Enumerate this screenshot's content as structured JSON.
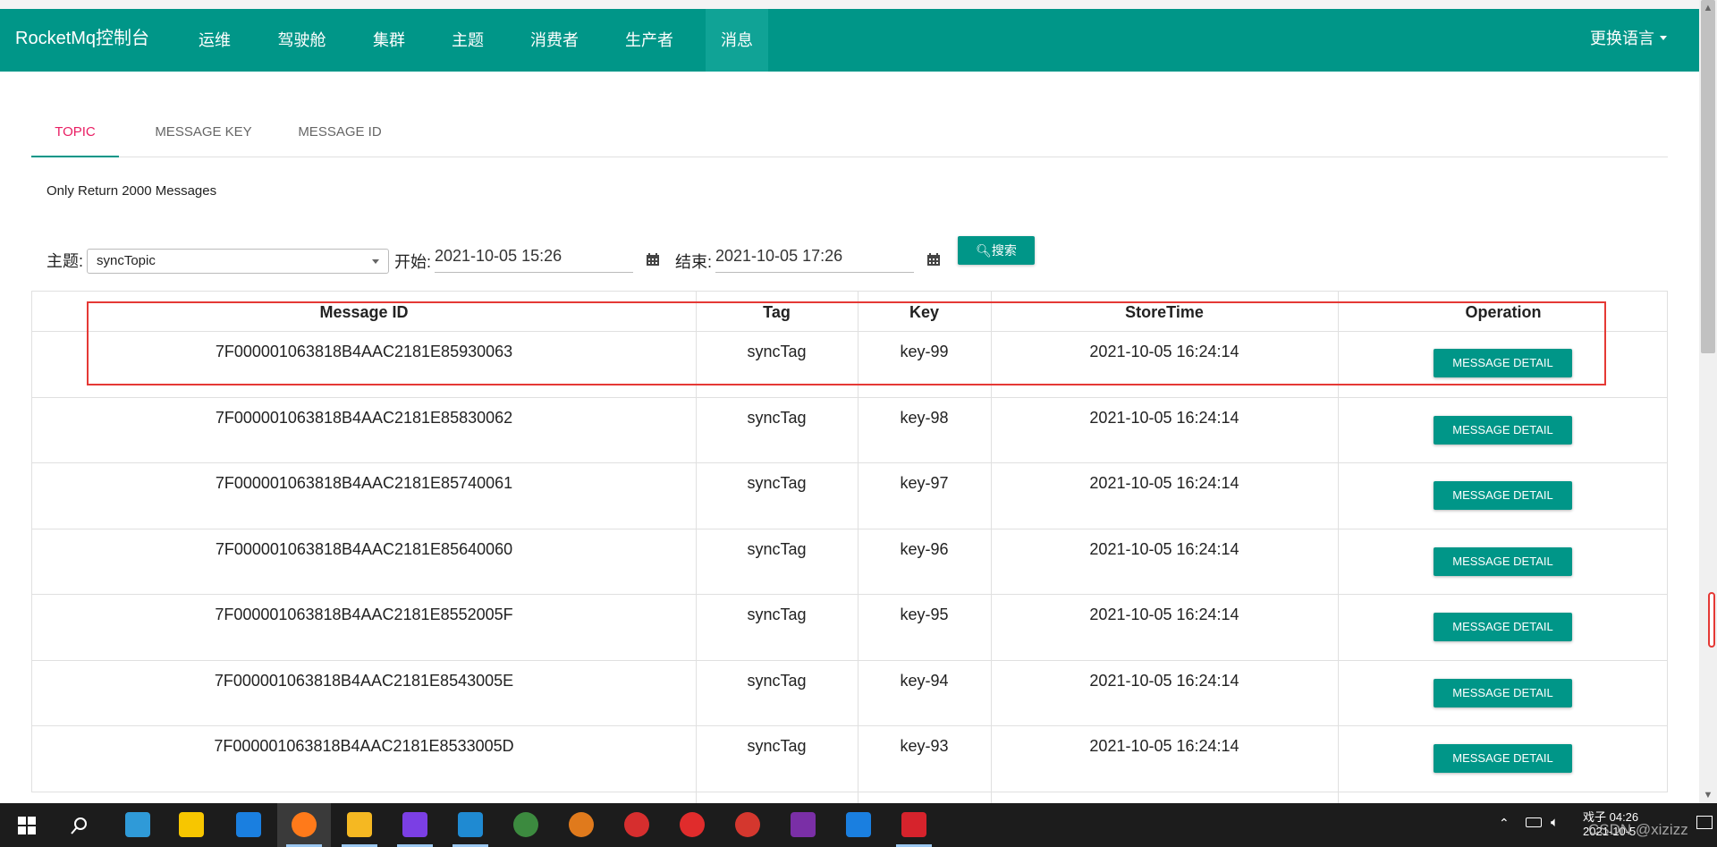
{
  "navbar": {
    "brand": "RocketMq控制台",
    "items": [
      {
        "label": "运维"
      },
      {
        "label": "驾驶舱"
      },
      {
        "label": "集群"
      },
      {
        "label": "主题"
      },
      {
        "label": "消费者"
      },
      {
        "label": "生产者"
      },
      {
        "label": "消息"
      }
    ],
    "active_item": "消息",
    "language_label": "更换语言"
  },
  "tabs": [
    {
      "label": "TOPIC"
    },
    {
      "label": "MESSAGE KEY"
    },
    {
      "label": "MESSAGE ID"
    }
  ],
  "active_tab": "TOPIC",
  "notice": "Only Return 2000 Messages",
  "filter": {
    "topic_label": "主题:",
    "topic_value": "syncTopic",
    "start_label": "开始:",
    "start_value": "2021-10-05 15:26",
    "end_label": "结束:",
    "end_value": "2021-10-05 17:26",
    "search_label": "搜索",
    "search_icon": "magnifier-icon",
    "calendar_icon": "calendar-icon"
  },
  "table": {
    "columns": [
      "Message ID",
      "Tag",
      "Key",
      "StoreTime",
      "Operation"
    ],
    "rows": [
      {
        "id": "7F000001063818B4AAC2181E85930063",
        "tag": "syncTag",
        "key": "key-99",
        "time": "2021-10-05 16:24:14",
        "op": "MESSAGE DETAIL"
      },
      {
        "id": "7F000001063818B4AAC2181E85830062",
        "tag": "syncTag",
        "key": "key-98",
        "time": "2021-10-05 16:24:14",
        "op": "MESSAGE DETAIL"
      },
      {
        "id": "7F000001063818B4AAC2181E85740061",
        "tag": "syncTag",
        "key": "key-97",
        "time": "2021-10-05 16:24:14",
        "op": "MESSAGE DETAIL"
      },
      {
        "id": "7F000001063818B4AAC2181E85640060",
        "tag": "syncTag",
        "key": "key-96",
        "time": "2021-10-05 16:24:14",
        "op": "MESSAGE DETAIL"
      },
      {
        "id": "7F000001063818B4AAC2181E8552005F",
        "tag": "syncTag",
        "key": "key-95",
        "time": "2021-10-05 16:24:14",
        "op": "MESSAGE DETAIL"
      },
      {
        "id": "7F000001063818B4AAC2181E8543005E",
        "tag": "syncTag",
        "key": "key-94",
        "time": "2021-10-05 16:24:14",
        "op": "MESSAGE DETAIL"
      },
      {
        "id": "7F000001063818B4AAC2181E8533005D",
        "tag": "syncTag",
        "key": "key-93",
        "time": "2021-10-05 16:24:14",
        "op": "MESSAGE DETAIL"
      }
    ]
  },
  "taskbar": {
    "time": "戏子 04:26",
    "date": "2021-10-5",
    "watermark": "CSDN @xizizz",
    "icons": [
      "windows-start-icon",
      "search-icon",
      "app-icon",
      "sticky-notes-icon",
      "star-app-icon",
      "firefox-icon",
      "file-explorer-icon",
      "intellij-icon",
      "vscode-icon",
      "browser-icon",
      "paw-app-icon",
      "game-app-icon",
      "netease-music-icon",
      "snail-app-icon",
      "onenote-icon",
      "star-app-2-icon",
      "wps-icon"
    ]
  },
  "colors": {
    "primary": "#009688",
    "active_tab": "#e91e63",
    "highlight": "#e53935"
  }
}
